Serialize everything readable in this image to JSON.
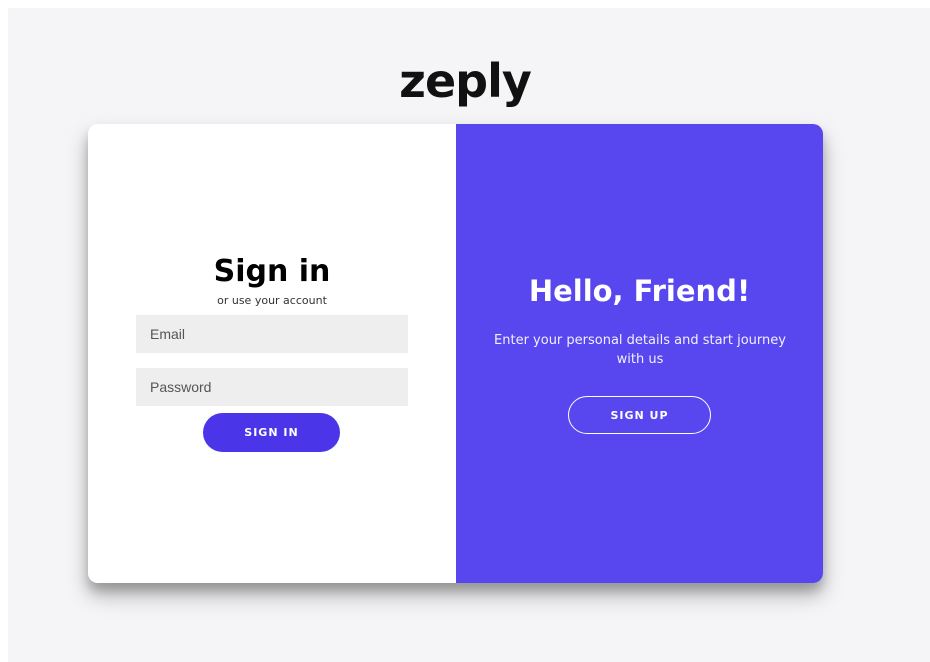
{
  "brand": {
    "logo_text": "zeply"
  },
  "signin": {
    "title": "Sign in",
    "subtitle": "or use your account",
    "email_placeholder": "Email",
    "password_placeholder": "Password",
    "button_label": "SIGN IN"
  },
  "welcome": {
    "title": "Hello, Friend!",
    "text": "Enter your personal details and start journey with us",
    "button_label": "SIGN UP"
  },
  "colors": {
    "page_background": "#f5f5f7",
    "panel_accent": "#5846ee",
    "signin_button": "#4b35e8",
    "input_background": "#eeeeee"
  }
}
